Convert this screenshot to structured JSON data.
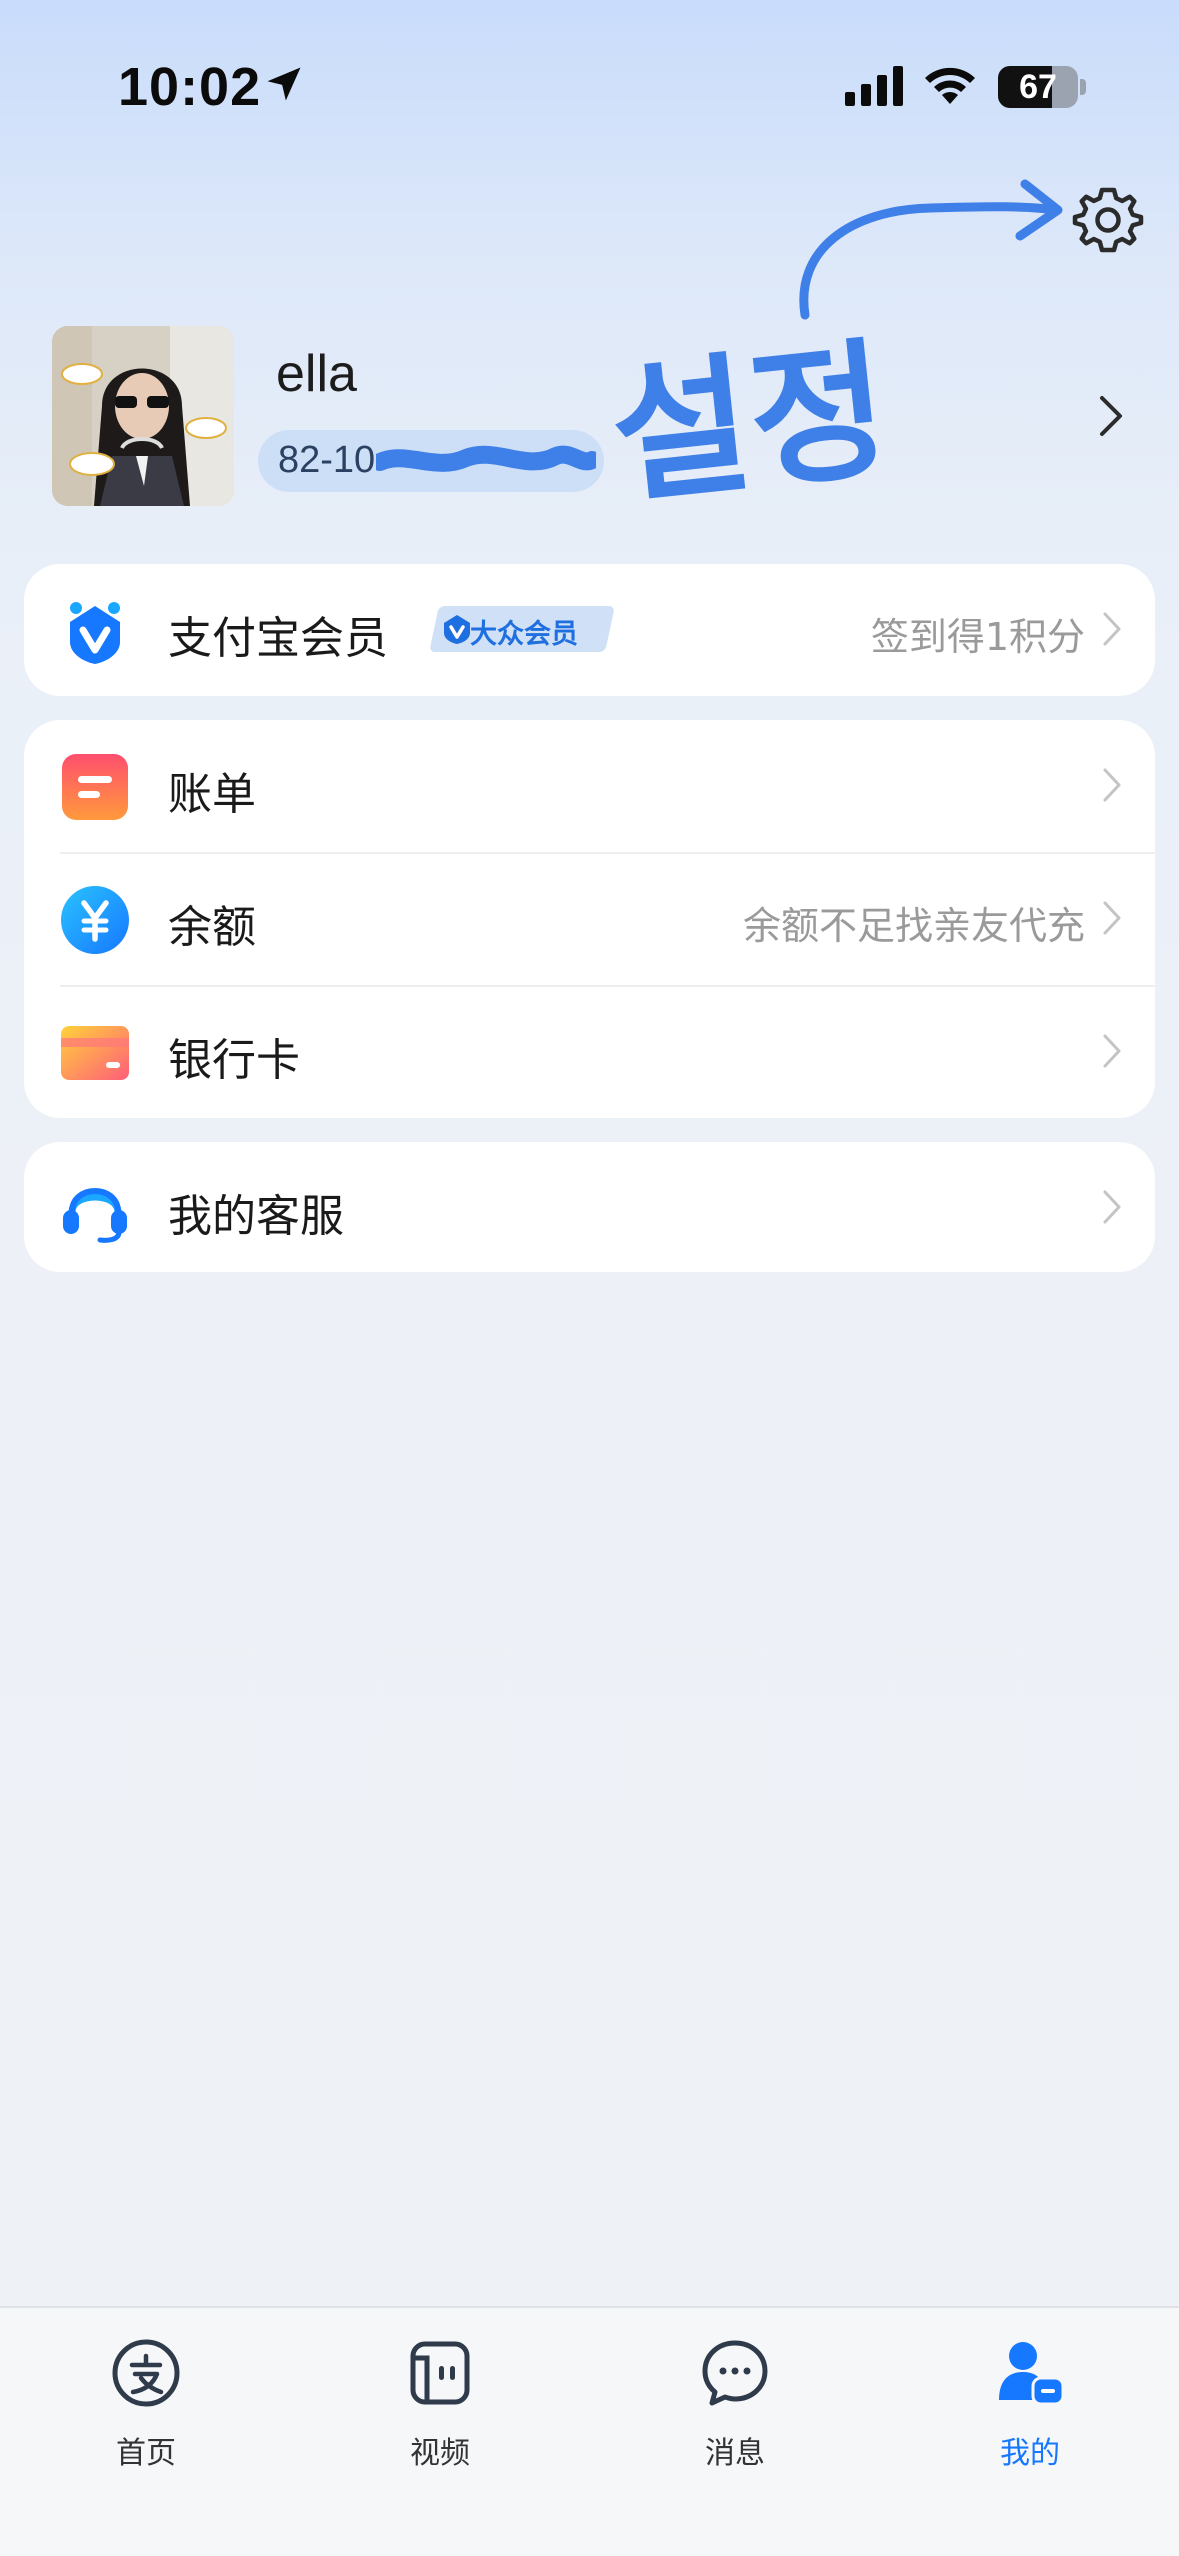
{
  "status_bar": {
    "time": "10:02",
    "battery_level": "67",
    "battery_fraction": 0.67
  },
  "header": {
    "settings_icon": "gear-icon"
  },
  "annotation": {
    "handwritten_text": "설정"
  },
  "profile": {
    "username": "ella",
    "phone": "82-10"
  },
  "membership": {
    "title": "支付宝会员",
    "badge": "大众会员",
    "right_text": "签到得1积分"
  },
  "menu": {
    "items": [
      {
        "label": "账单",
        "right_text": ""
      },
      {
        "label": "余额",
        "right_text": "余额不足找亲友代充"
      },
      {
        "label": "银行卡",
        "right_text": ""
      }
    ]
  },
  "service": {
    "label": "我的客服"
  },
  "tabbar": {
    "tabs": [
      {
        "label": "首页",
        "icon": "alipay-icon"
      },
      {
        "label": "视频",
        "icon": "video-icon"
      },
      {
        "label": "消息",
        "icon": "message-icon"
      },
      {
        "label": "我的",
        "icon": "profile-icon",
        "active": true
      }
    ]
  },
  "colors": {
    "accent": "#1677ff",
    "annotation": "#3f7fe8"
  }
}
